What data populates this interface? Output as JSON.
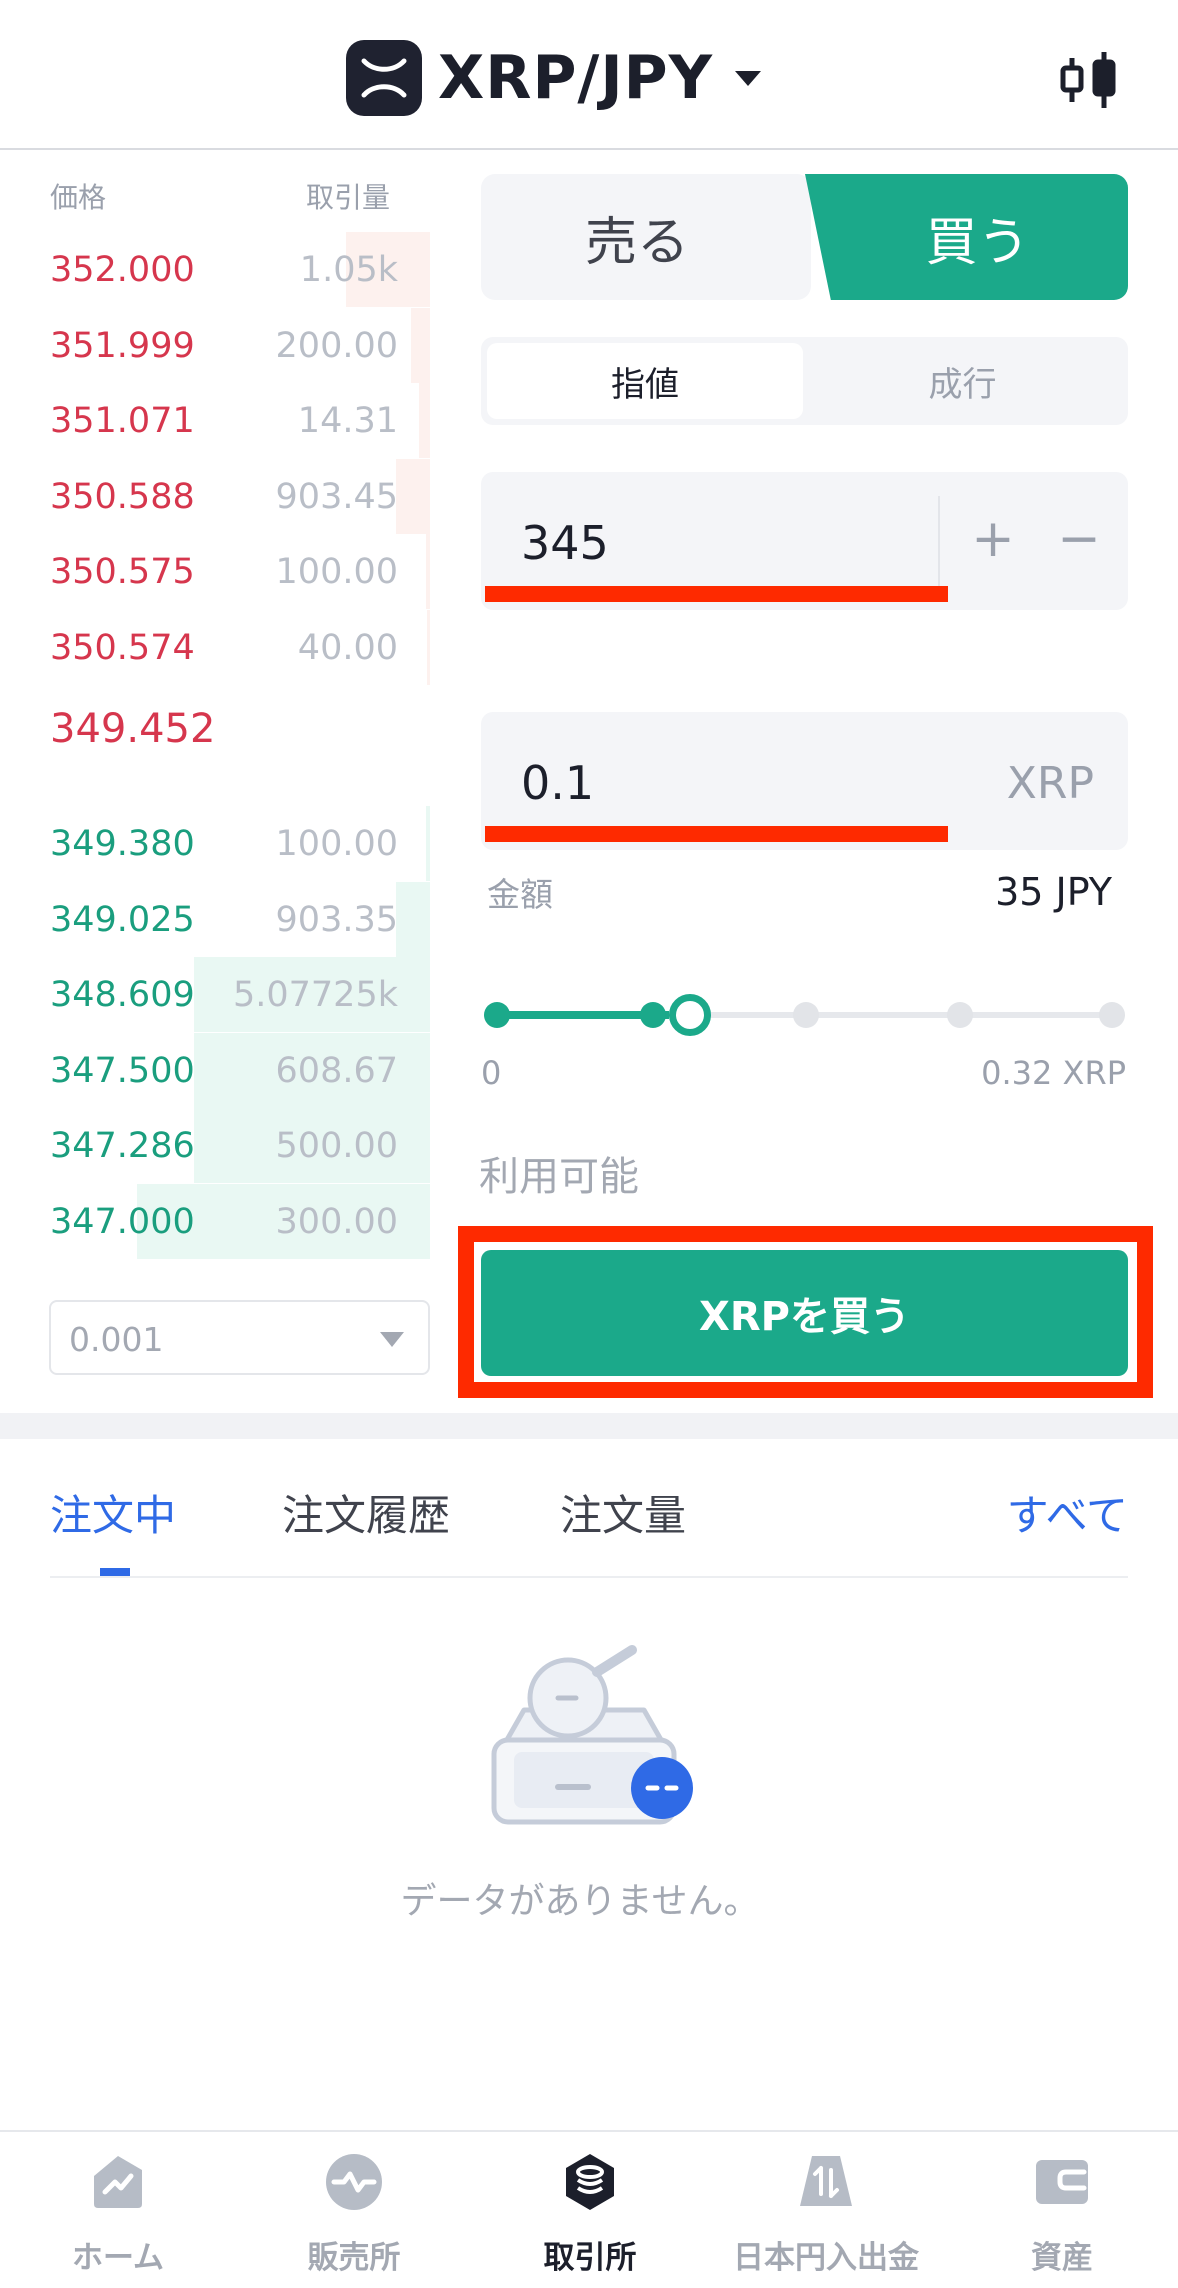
{
  "header": {
    "pair": "XRP/JPY",
    "logo_icon": "xrp-logo-icon",
    "chart_icon": "candlestick-chart-icon"
  },
  "orderbook": {
    "price_header": "価格",
    "qty_header": "取引量",
    "asks": [
      {
        "price": "352.000",
        "qty": "1.05k",
        "depth": 0.22
      },
      {
        "price": "351.999",
        "qty": "200.00",
        "depth": 0.05
      },
      {
        "price": "351.071",
        "qty": "14.31",
        "depth": 0.03
      },
      {
        "price": "350.588",
        "qty": "903.45",
        "depth": 0.09
      },
      {
        "price": "350.575",
        "qty": "100.00",
        "depth": 0.01
      },
      {
        "price": "350.574",
        "qty": "40.00",
        "depth": 0.005
      }
    ],
    "last_price": "349.452",
    "bids": [
      {
        "price": "349.380",
        "qty": "100.00",
        "depth": 0.01
      },
      {
        "price": "349.025",
        "qty": "903.35",
        "depth": 0.09
      },
      {
        "price": "348.609",
        "qty": "5.07725k",
        "depth": 0.62
      },
      {
        "price": "347.500",
        "qty": "608.67",
        "depth": 0.62
      },
      {
        "price": "347.286",
        "qty": "500.00",
        "depth": 0.62
      },
      {
        "price": "347.000",
        "qty": "300.00",
        "depth": 0.77
      }
    ],
    "precision": "0.001"
  },
  "trade": {
    "sell_label": "売る",
    "buy_label": "買う",
    "limit_label": "指値",
    "market_label": "成行",
    "price_value": "345",
    "plus": "+",
    "minus": "−",
    "qty_value": "0.1",
    "qty_unit": "XRP",
    "amount_label": "金額",
    "amount_value": "35 JPY",
    "slider_min": "0",
    "slider_max": "0.32 XRP",
    "slider_position": 0.3,
    "available_label": "利用可能",
    "submit_label": "XRPを買う"
  },
  "orders": {
    "tab_open": "注文中",
    "tab_history": "注文履歴",
    "tab_volume": "注文量",
    "all_label": "すべて",
    "empty_text": "データがありません。"
  },
  "nav": {
    "items": [
      {
        "label": "ホーム",
        "icon": "home-icon"
      },
      {
        "label": "販売所",
        "icon": "exchange-icon"
      },
      {
        "label": "取引所",
        "icon": "coin-stack-icon"
      },
      {
        "label": "日本円入出金",
        "icon": "deposit-withdraw-icon"
      },
      {
        "label": "資産",
        "icon": "wallet-icon"
      }
    ]
  },
  "colors": {
    "accent_green": "#1ba98a",
    "ask_red": "#d6364d",
    "link_blue": "#2f6ae6",
    "highlight_red": "#fe2a00"
  }
}
